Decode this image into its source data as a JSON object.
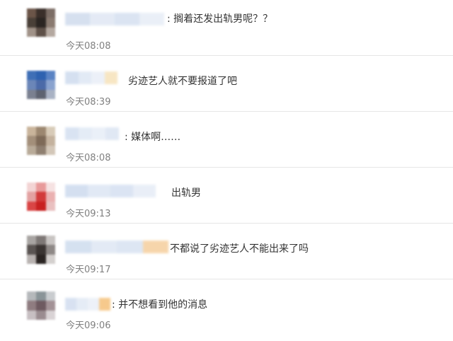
{
  "comments": [
    {
      "text": ":  搁着还发出轨男呢？？",
      "time": "今天08:08",
      "avatar_colors": [
        "#6b5548",
        "#3a2f2a",
        "#7c6e66",
        "#4a4038",
        "#2b2522",
        "#8a7a70",
        "#a09288",
        "#5e5048",
        "#b4a8a0"
      ],
      "name_colors": [
        "#c9d6ea",
        "#dbe4f2",
        "#cfdcee",
        "#e3eaf5"
      ]
    },
    {
      "text": "劣迹艺人就不要报道了吧",
      "time": "今天08:39",
      "avatar_colors": [
        "#3f6fb6",
        "#2e62b0",
        "#5a83c4",
        "#6b86b8",
        "#4b6aa8",
        "#8aa3cf",
        "#7a8090",
        "#5d6270",
        "#a9b2c4"
      ],
      "name_colors": [
        "#c7d6ec",
        "#d9e3f2",
        "#e6ecf6",
        "#f5deb0"
      ]
    },
    {
      "text": ":  媒体啊……",
      "time": "今天08:08",
      "avatar_colors": [
        "#c9b49b",
        "#9c8770",
        "#d8cbb8",
        "#a38f7a",
        "#7e6a58",
        "#c4b29e",
        "#b8aa98",
        "#8f7f70",
        "#d3c7b8"
      ],
      "name_colors": [
        "#cddaee",
        "#dce6f3",
        "#e4ebf6",
        "#d6e1f1"
      ]
    },
    {
      "text": "出轨男",
      "time": "今天09:13",
      "avatar_colors": [
        "#f3d4d4",
        "#e89a9a",
        "#f6e2e2",
        "#e3a1a1",
        "#d23a3a",
        "#eab0b0",
        "#d94545",
        "#c82020",
        "#e9c0c0"
      ],
      "name_colors": [
        "#c6d5ec",
        "#d7e2f2",
        "#cfdcef",
        "#e2e9f5"
      ]
    },
    {
      "text": "不都说了劣迹艺人不能出来了吗",
      "time": "今天09:17",
      "avatar_colors": [
        "#a8a4a2",
        "#7e7876",
        "#c8c4c2",
        "#5a5452",
        "#3a3432",
        "#8e8886",
        "#b8b2b0",
        "#2a2422",
        "#d4d0ce"
      ],
      "name_colors": [
        "#c8d7ec",
        "#dae4f2",
        "#d2deef",
        "#f4c890"
      ]
    },
    {
      "text": ":  并不想看到他的消息",
      "time": "今天09:06",
      "avatar_colors": [
        "#b5b8bb",
        "#8a9498",
        "#c9cccf",
        "#8f7c80",
        "#6e5a60",
        "#a39296",
        "#c7bfc2",
        "#9a8c90",
        "#d9d3d5"
      ],
      "name_colors": [
        "#cbd8ed",
        "#dde6f3",
        "#e7edf6",
        "#f3b866"
      ]
    }
  ]
}
